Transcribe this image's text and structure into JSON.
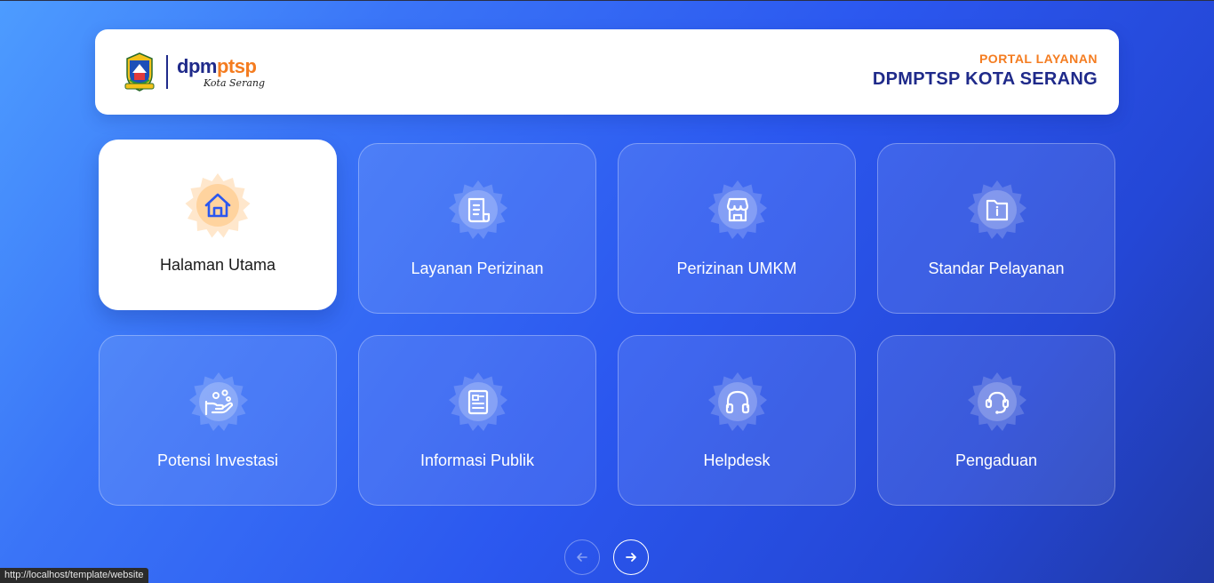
{
  "header": {
    "logo": {
      "text_main_a": "dpm",
      "text_main_b": "ptsp",
      "text_sub": "Kota Serang"
    },
    "portal_label": "PORTAL LAYANAN",
    "portal_title": "DPMPTSP KOTA SERANG"
  },
  "colors": {
    "accent_orange": "#f47c20",
    "brand_navy": "#1f2a8a",
    "icon_blue": "#2b57ef"
  },
  "menu": [
    {
      "label": "Halaman Utama",
      "icon": "home-icon",
      "active": true
    },
    {
      "label": "Layanan Perizinan",
      "icon": "document-icon",
      "active": false
    },
    {
      "label": "Perizinan UMKM",
      "icon": "store-icon",
      "active": false
    },
    {
      "label": "Standar Pelayanan",
      "icon": "folder-info-icon",
      "active": false
    },
    {
      "label": "Potensi Investasi",
      "icon": "hand-coins-icon",
      "active": false
    },
    {
      "label": "Informasi Publik",
      "icon": "news-icon",
      "active": false
    },
    {
      "label": "Helpdesk",
      "icon": "headphones-icon",
      "active": false
    },
    {
      "label": "Pengaduan",
      "icon": "headset-icon",
      "active": false
    }
  ],
  "pagination": {
    "prev_icon": "arrow-left-icon",
    "next_icon": "arrow-right-icon"
  },
  "status_bar": {
    "url": "http://localhost/template/website"
  }
}
